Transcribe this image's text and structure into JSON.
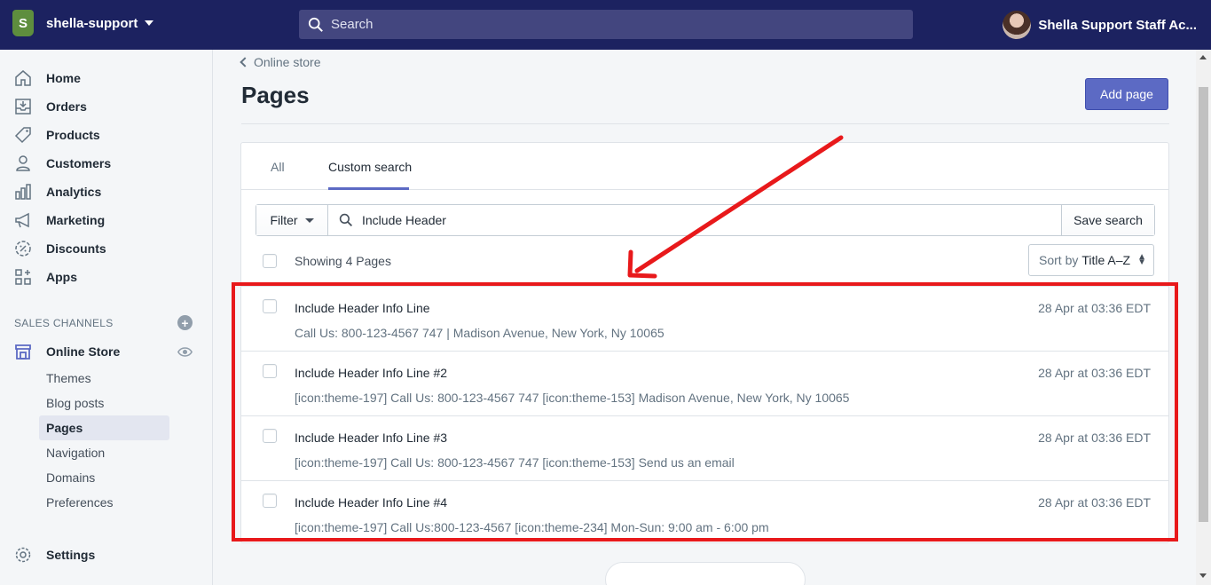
{
  "topbar": {
    "store_name": "shella-support",
    "search_placeholder": "Search",
    "user_name": "Shella Support Staff Ac..."
  },
  "sidebar": {
    "items": [
      {
        "label": "Home",
        "icon": "home-icon"
      },
      {
        "label": "Orders",
        "icon": "orders-icon"
      },
      {
        "label": "Products",
        "icon": "tag-icon"
      },
      {
        "label": "Customers",
        "icon": "person-icon"
      },
      {
        "label": "Analytics",
        "icon": "bar-chart-icon"
      },
      {
        "label": "Marketing",
        "icon": "megaphone-icon"
      },
      {
        "label": "Discounts",
        "icon": "discount-icon"
      },
      {
        "label": "Apps",
        "icon": "apps-icon"
      }
    ],
    "sales_channels_label": "SALES CHANNELS",
    "online_store_label": "Online Store",
    "sub_items": [
      "Themes",
      "Blog posts",
      "Pages",
      "Navigation",
      "Domains",
      "Preferences"
    ],
    "active_sub_item": "Pages",
    "settings_label": "Settings"
  },
  "main": {
    "breadcrumb": "Online store",
    "title": "Pages",
    "add_button": "Add page",
    "tabs": [
      "All",
      "Custom search"
    ],
    "active_tab": "Custom search",
    "filter_label": "Filter",
    "query": "Include Header",
    "save_search_label": "Save search",
    "showing_text": "Showing 4 Pages",
    "sort_prefix": "Sort by",
    "sort_value": "Title A–Z",
    "rows": [
      {
        "title": "Include Header Info Line",
        "desc": "Call Us: 800-123-4567 747 | Madison Avenue, New York, Ny 10065",
        "date": "28 Apr at 03:36 EDT"
      },
      {
        "title": "Include Header Info Line #2",
        "desc": "[icon:theme-197] Call Us: 800-123-4567 747 [icon:theme-153] Madison Avenue, New York, Ny 10065",
        "date": "28 Apr at 03:36 EDT"
      },
      {
        "title": "Include Header Info Line #3",
        "desc": "[icon:theme-197] Call Us: 800-123-4567 747 [icon:theme-153] Send us an email",
        "date": "28 Apr at 03:36 EDT"
      },
      {
        "title": "Include Header Info Line #4",
        "desc": "[icon:theme-197] Call Us:800-123-4567 [icon:theme-234] Mon-Sun: 9:00 am - 6:00 pm",
        "date": "28 Apr at 03:36 EDT"
      }
    ]
  },
  "colors": {
    "topbar": "#1c2260",
    "primary_button": "#5c6ac4",
    "annotation": "#e8191b"
  }
}
